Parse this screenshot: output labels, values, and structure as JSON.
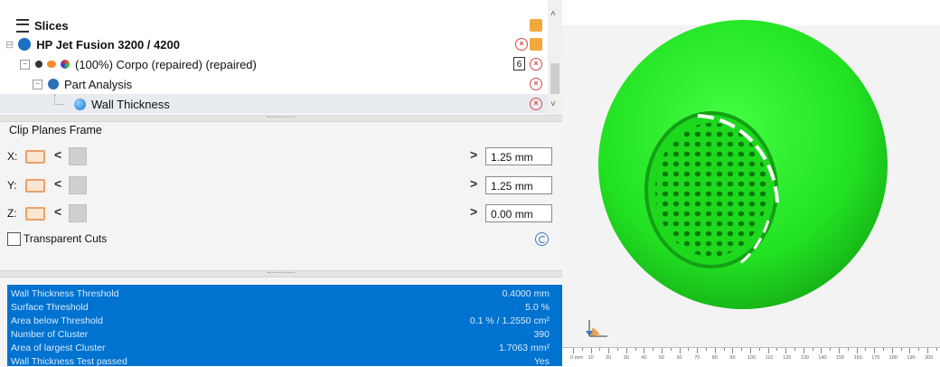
{
  "tree": {
    "slices_label": "Slices",
    "printer_label": "HP Jet Fusion 3200 / 4200",
    "part_label": "(100%) Corpo (repaired) (repaired)",
    "part_badge": "6",
    "analysis_label": "Part Analysis",
    "wall_label": "Wall Thickness"
  },
  "clip": {
    "title": "Clip Planes Frame",
    "x_label": "X:",
    "y_label": "Y:",
    "z_label": "Z:",
    "x_value": "1.25 mm",
    "y_value": "1.25 mm",
    "z_value": "0.00 mm",
    "transparent_label": "Transparent Cuts",
    "transparent_checked": false
  },
  "results": [
    {
      "label": "Wall Thickness Threshold",
      "value": "0.4000 mm"
    },
    {
      "label": "Surface Threshold",
      "value": "5.0 %"
    },
    {
      "label": "Area below Threshold",
      "value": "0.1 % / 1.2550 cm²"
    },
    {
      "label": "Number of Cluster",
      "value": "390"
    },
    {
      "label": "Area of largest Cluster",
      "value": "1.7063 mm²"
    },
    {
      "label": "Wall Thickness Test passed",
      "value": "Yes"
    }
  ],
  "viewport": {
    "model_color": "#22ee22",
    "ruler_labels": [
      "0 mm",
      "10",
      "20",
      "30",
      "40",
      "50",
      "60",
      "70",
      "80",
      "90",
      "100",
      "110",
      "120",
      "130",
      "140",
      "150",
      "160",
      "170",
      "180",
      "190",
      "200"
    ]
  },
  "colors": {
    "accent_blue": "#0072cf",
    "selection": "#e8ebf0"
  }
}
